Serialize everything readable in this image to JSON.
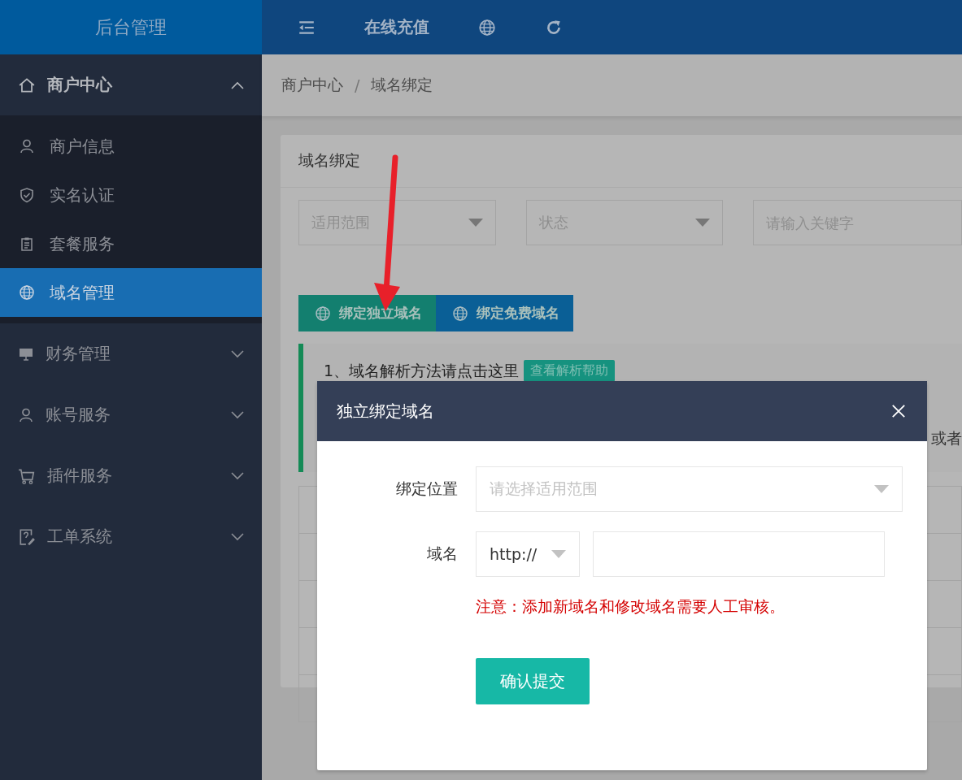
{
  "header": {
    "brand": "后台管理",
    "recharge_link": "在线充值"
  },
  "sidebar": {
    "items": [
      {
        "label": "商户中心",
        "expanded": true,
        "children": [
          {
            "label": "商户信息",
            "selected": false
          },
          {
            "label": "实名认证",
            "selected": false
          },
          {
            "label": "套餐服务",
            "selected": false
          },
          {
            "label": "域名管理",
            "selected": true
          }
        ]
      },
      {
        "label": "财务管理",
        "expanded": false
      },
      {
        "label": "账号服务",
        "expanded": false
      },
      {
        "label": "插件服务",
        "expanded": false
      },
      {
        "label": "工单系统",
        "expanded": false
      }
    ]
  },
  "breadcrumb": {
    "items": [
      "商户中心",
      "域名绑定"
    ],
    "separator": "/"
  },
  "card": {
    "title": "域名绑定",
    "filters": [
      {
        "kind": "select",
        "placeholder": "适用范围"
      },
      {
        "kind": "select",
        "placeholder": "状态"
      },
      {
        "kind": "input",
        "placeholder": "请输入关键字"
      }
    ],
    "buttons": [
      {
        "label": "绑定独立域名",
        "color": "#137f6f"
      },
      {
        "label": "绑定免费域名",
        "color": "#0a5f96"
      }
    ],
    "notice": {
      "line_1": "1、域名解析方法请点击这里",
      "help_tag": "查看解析帮助",
      "line_2": "或者"
    }
  },
  "modal": {
    "title": "独立绑定域名",
    "location_label": "绑定位置",
    "location_placeholder": "请选择适用范围",
    "domain_label": "域名",
    "protocol": "http://",
    "warning": "注意：添加新域名和修改域名需要人工审核。",
    "submit": "确认提交"
  }
}
